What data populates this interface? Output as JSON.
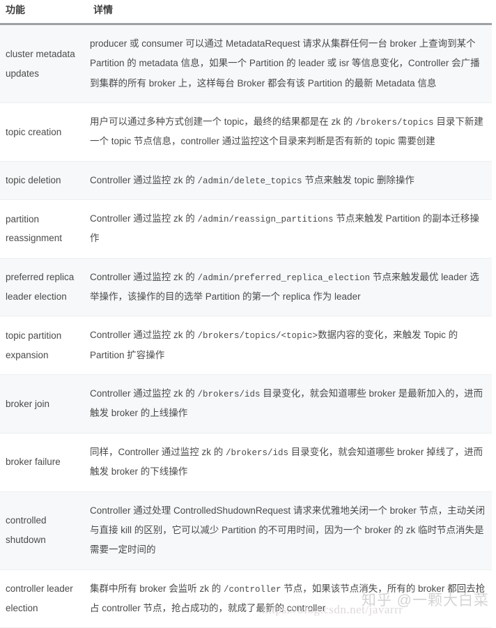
{
  "table": {
    "headers": {
      "feature": "功能",
      "detail": "详情"
    },
    "rows": [
      {
        "feature": "cluster metadata updates",
        "detail_parts": [
          {
            "type": "text",
            "value": "producer 或 consumer 可以通过 MetadataRequest 请求从集群任何一台 broker 上查询到某个 Partition 的 metadata 信息，如果一个 Partition 的 leader 或 isr 等信息变化，Controller 会广播到集群的所有 broker 上，这样每台 Broker 都会有该 Partition 的最新 Metadata 信息"
          }
        ]
      },
      {
        "feature": "topic creation",
        "detail_parts": [
          {
            "type": "text",
            "value": "用户可以通过多种方式创建一个 topic，最终的结果都是在 zk 的 "
          },
          {
            "type": "code",
            "value": "/brokers/topics"
          },
          {
            "type": "text",
            "value": " 目录下新建一个 topic 节点信息，controller 通过监控这个目录来判断是否有新的 topic 需要创建"
          }
        ]
      },
      {
        "feature": "topic deletion",
        "detail_parts": [
          {
            "type": "text",
            "value": "Controller 通过监控 zk 的 "
          },
          {
            "type": "code",
            "value": "/admin/delete_topics"
          },
          {
            "type": "text",
            "value": " 节点来触发 topic 删除操作"
          }
        ]
      },
      {
        "feature": "partition reassignment",
        "detail_parts": [
          {
            "type": "text",
            "value": "Controller 通过监控 zk 的 "
          },
          {
            "type": "code",
            "value": "/admin/reassign_partitions"
          },
          {
            "type": "text",
            "value": " 节点来触发 Partition 的副本迁移操作"
          }
        ]
      },
      {
        "feature": "preferred replica leader election",
        "detail_parts": [
          {
            "type": "text",
            "value": "Controller 通过监控 zk 的 "
          },
          {
            "type": "code",
            "value": "/admin/preferred_replica_election"
          },
          {
            "type": "text",
            "value": " 节点来触发最优 leader 选举操作，该操作的目的选举 Partition 的第一个 replica 作为 leader"
          }
        ]
      },
      {
        "feature": "topic partition expansion",
        "detail_parts": [
          {
            "type": "text",
            "value": "Controller 通过监控 zk 的 "
          },
          {
            "type": "code",
            "value": "/brokers/topics/<topic>"
          },
          {
            "type": "text",
            "value": "数据内容的变化，来触发 Topic 的 Partition 扩容操作"
          }
        ]
      },
      {
        "feature": "broker join",
        "detail_parts": [
          {
            "type": "text",
            "value": "Controller 通过监控 zk 的 "
          },
          {
            "type": "code",
            "value": "/brokers/ids"
          },
          {
            "type": "text",
            "value": " 目录变化，就会知道哪些 broker 是最新加入的，进而触发 broker 的上线操作"
          }
        ]
      },
      {
        "feature": "broker failure",
        "detail_parts": [
          {
            "type": "text",
            "value": "同样，Controller 通过监控 zk 的 "
          },
          {
            "type": "code",
            "value": "/brokers/ids"
          },
          {
            "type": "text",
            "value": " 目录变化，就会知道哪些 broker 掉线了，进而触发 broker 的下线操作"
          }
        ]
      },
      {
        "feature": "controlled shutdown",
        "detail_parts": [
          {
            "type": "text",
            "value": "Controller 通过处理 ControlledShudownRequest 请求来优雅地关闭一个 broker 节点，主动关闭与直接 kill 的区别，它可以减少 Partition 的不可用时间，因为一个 broker 的 zk 临时节点消失是需要一定时间的"
          }
        ]
      },
      {
        "feature": "controller leader election",
        "detail_parts": [
          {
            "type": "text",
            "value": "集群中所有 broker 会监听 zk 的 "
          },
          {
            "type": "code",
            "value": "/controller"
          },
          {
            "type": "text",
            "value": " 节点，如果该节点消失，所有的 broker 都回去抢占 controller 节点，抢占成功的，就成了最新的 controller"
          }
        ]
      }
    ]
  },
  "watermark": {
    "handle": "知乎 @一颗大白菜",
    "url": "https://blog.csdn.net/javarrr"
  }
}
